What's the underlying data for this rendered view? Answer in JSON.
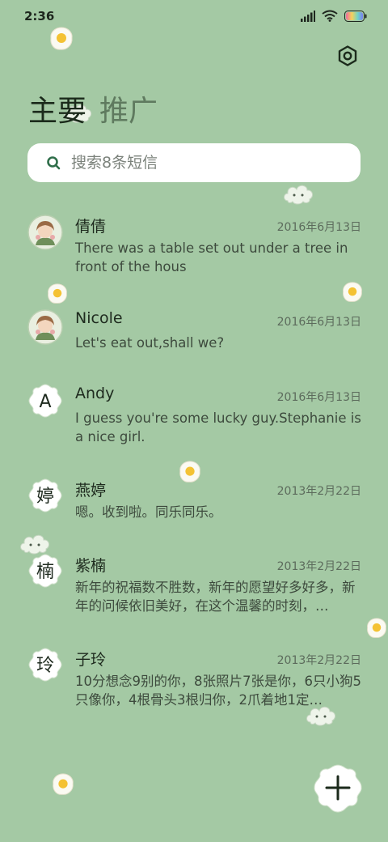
{
  "status_bar": {
    "time": "2:36"
  },
  "tabs": [
    {
      "label": "主要"
    },
    {
      "label": "推广"
    }
  ],
  "search": {
    "placeholder": "搜索8条短信"
  },
  "conversations": [
    {
      "name": "倩倩",
      "date": "2016年6月13日",
      "preview": "There was a table set out under a tree in front of the hous",
      "avatar_type": "photo",
      "avatar_text": ""
    },
    {
      "name": "Nicole",
      "date": "2016年6月13日",
      "preview": "Let's eat out,shall we?",
      "avatar_type": "photo",
      "avatar_text": ""
    },
    {
      "name": "Andy",
      "date": "2016年6月13日",
      "preview": "I guess you're some lucky guy.Stephanie is a nice girl.",
      "avatar_type": "letter",
      "avatar_text": "A"
    },
    {
      "name": "燕婷",
      "date": "2013年2月22日",
      "preview": "嗯。收到啦。同乐同乐。",
      "avatar_type": "letter",
      "avatar_text": "婷"
    },
    {
      "name": "紫楠",
      "date": "2013年2月22日",
      "preview": "新年的祝福数不胜数，新年的愿望好多好多，新年的问候依旧美好，在这个温馨的时刻，…",
      "avatar_type": "letter",
      "avatar_text": "楠"
    },
    {
      "name": "子玲",
      "date": "2013年2月22日",
      "preview": "10分想念9别的你，8张照片7张是你，6只小狗5只像你，4根骨头3根归你，2爪着地1定…",
      "avatar_type": "letter",
      "avatar_text": "玲"
    }
  ],
  "icons": {
    "settings": "settings-gear-icon",
    "search": "search-icon",
    "fab": "add-icon",
    "signal": "signal-icon",
    "wifi": "wifi-icon",
    "battery": "battery-icon"
  },
  "colors": {
    "background": "#a4c9a4",
    "card": "#ffffff",
    "accent": "#2f6e4a",
    "battery_gradient": [
      "#f06aa0",
      "#f5d25a",
      "#6fd3c8",
      "#7a7ef2"
    ]
  }
}
